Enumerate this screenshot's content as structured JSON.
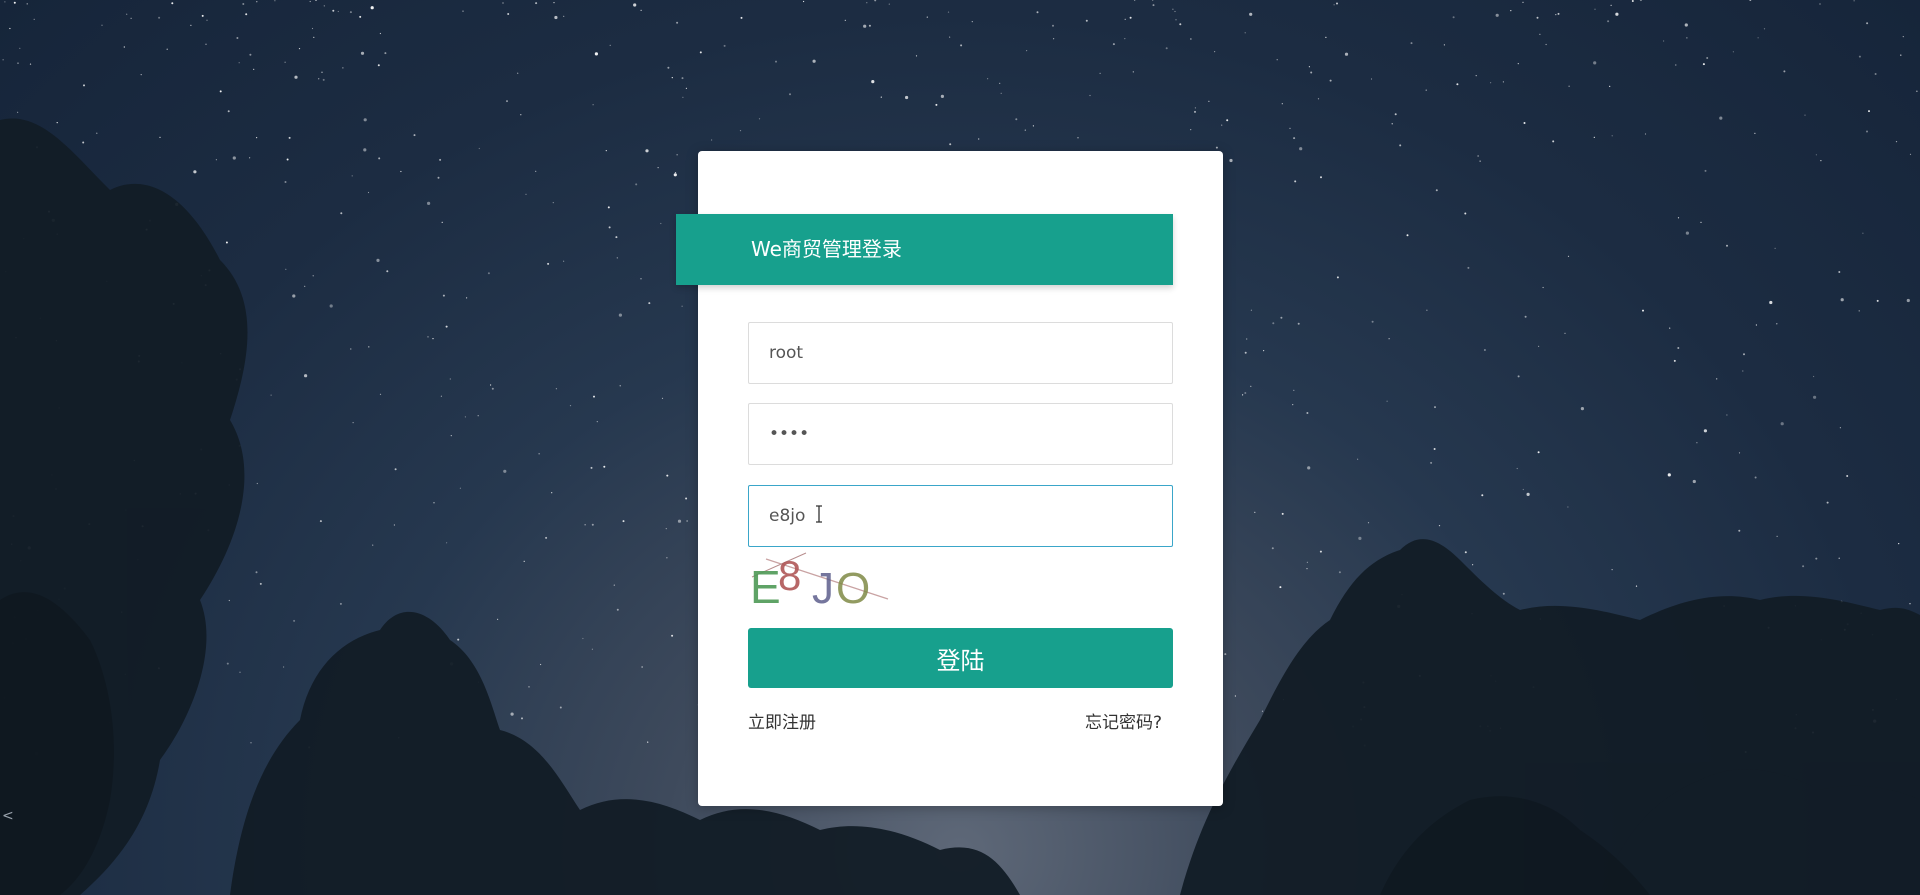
{
  "login": {
    "title": "We商贸管理登录",
    "username_value": "root",
    "password_value": "1234",
    "captcha_input_value": "e8jo",
    "captcha_image_text": "E8JO",
    "submit_label": "登陆",
    "register_link": "立即注册",
    "forgot_link": "忘记密码?"
  },
  "edge_glyph": "<",
  "colors": {
    "accent": "#17a08d",
    "focus_border": "#3aa6c9",
    "card_background": "#ffffff"
  },
  "icons": {
    "text_cursor": "i-beam-cursor-icon"
  }
}
